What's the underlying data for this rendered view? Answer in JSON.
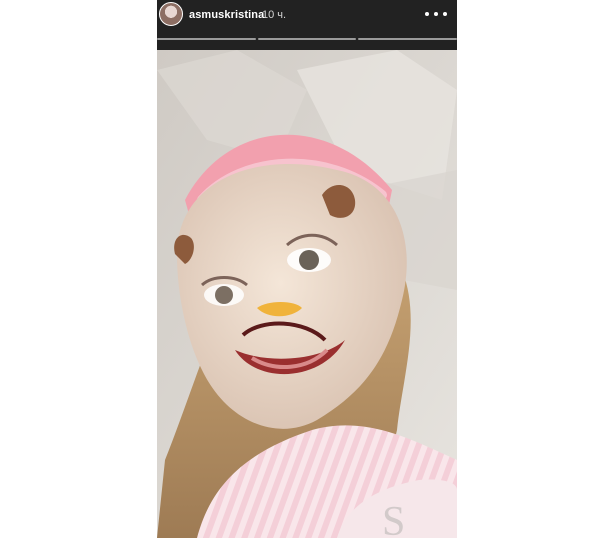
{
  "story": {
    "username": "asmuskristina",
    "time": "10 ч."
  },
  "icons": {
    "more": "more-dots-icon",
    "avatar": "profile-avatar"
  }
}
